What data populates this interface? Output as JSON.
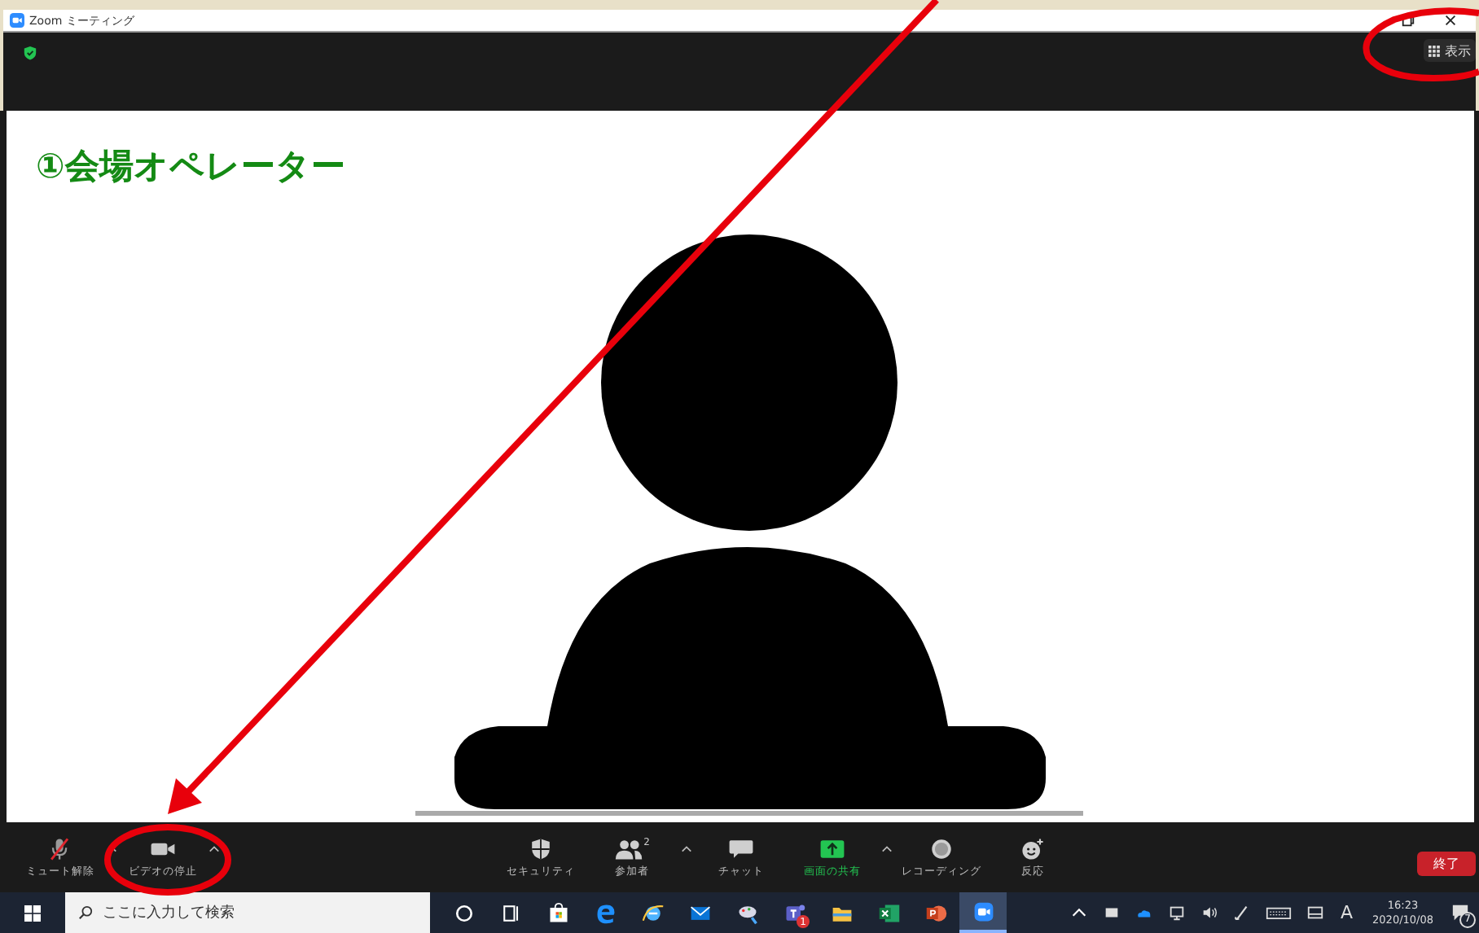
{
  "window": {
    "title": "Zoom ミーティング"
  },
  "header": {
    "view_button": "表示"
  },
  "video": {
    "participant_name": "①会場オペレーター"
  },
  "toolbar": {
    "left": [
      {
        "kind": "mic",
        "label": "ミュート解除",
        "muted": true,
        "caret": true
      },
      {
        "kind": "video",
        "label": "ビデオの停止",
        "muted": false,
        "caret": true
      }
    ],
    "center": [
      {
        "kind": "security",
        "label": "セキュリティ",
        "caret": false
      },
      {
        "kind": "participants",
        "label": "参加者",
        "count": "2",
        "caret": true
      },
      {
        "kind": "chat",
        "label": "チャット",
        "caret": false
      },
      {
        "kind": "share",
        "label": "画面の共有",
        "caret": true
      },
      {
        "kind": "record",
        "label": "レコーディング",
        "caret": false
      },
      {
        "kind": "reaction",
        "label": "反応",
        "caret": false
      }
    ],
    "end_button": "終了"
  },
  "taskbar": {
    "search": {
      "placeholder": "ここに入力して検索"
    },
    "apps": [
      {
        "kind": "cortana",
        "selected": false
      },
      {
        "kind": "taskview",
        "selected": false
      },
      {
        "kind": "store",
        "selected": false
      },
      {
        "kind": "edge",
        "selected": false
      },
      {
        "kind": "ie",
        "selected": false
      },
      {
        "kind": "mail",
        "selected": false
      },
      {
        "kind": "paint",
        "selected": false
      },
      {
        "kind": "teams",
        "selected": false,
        "badge": "1"
      },
      {
        "kind": "explorer",
        "selected": false
      },
      {
        "kind": "excel",
        "selected": false
      },
      {
        "kind": "powerpoint",
        "selected": false
      },
      {
        "kind": "zoom",
        "selected": true
      }
    ],
    "tray": {
      "ime": "A",
      "time": "16:23",
      "date": "2020/10/08",
      "notifications": "7"
    }
  }
}
